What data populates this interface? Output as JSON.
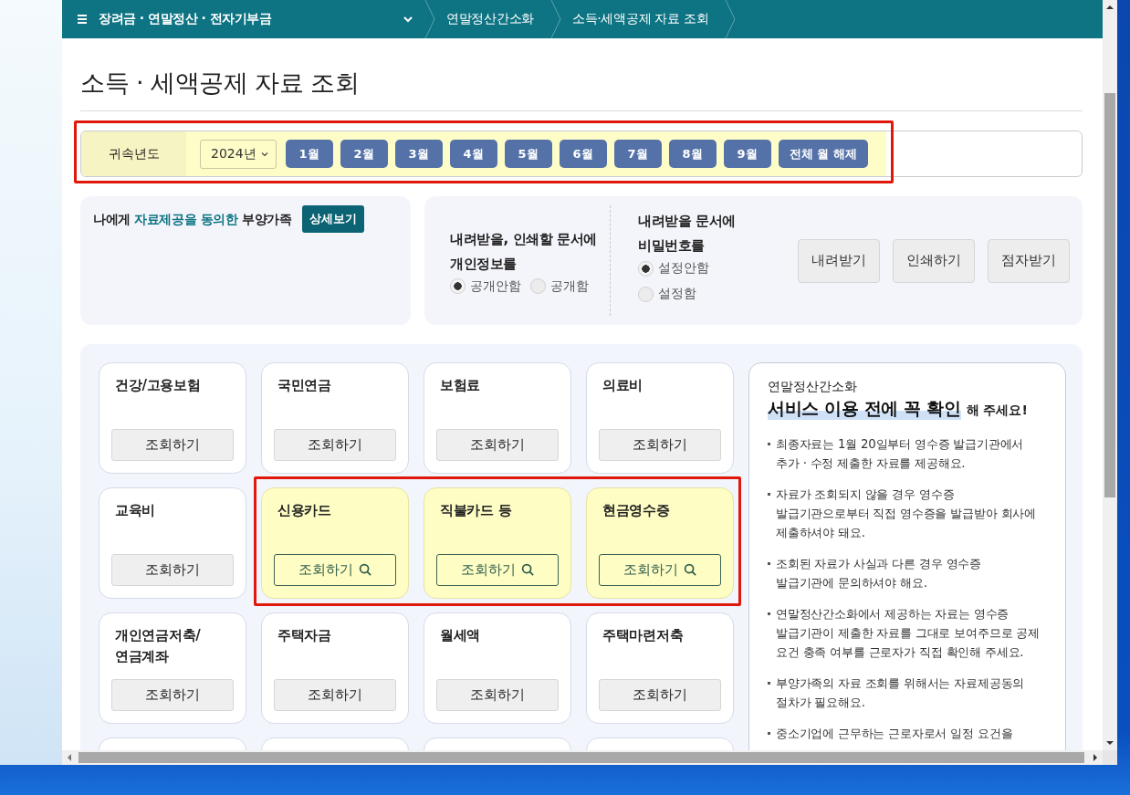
{
  "nav": {
    "title": "장려금 · 연말정산 · 전자기부금",
    "breadcrumbs": [
      "연말정산간소화",
      "소득·세액공제 자료 조회"
    ]
  },
  "page_title": "소득 · 세액공제 자료 조회",
  "filter": {
    "highlighted": true,
    "label": "귀속년도",
    "year": "2024년",
    "months": [
      "1월",
      "2월",
      "3월",
      "4월",
      "5월",
      "6월",
      "7월",
      "8월",
      "9월",
      "전체 월 해제"
    ]
  },
  "consent": {
    "text": "나에게 **자료제공을 동의한** 부양가족",
    "button": "상세보기"
  },
  "options": [
    {
      "kind": "inline",
      "question": "내려받을, 인쇄할 문서에\n개인정보를",
      "choices": [
        {
          "label": "공개안함",
          "selected": true
        },
        {
          "label": "공개함",
          "selected": false
        }
      ]
    },
    {
      "kind": "stacked",
      "question": "내려받을 문서에\n비밀번호를",
      "choices": [
        {
          "label": "설정안함",
          "selected": true
        },
        {
          "label": "설정함",
          "selected": false
        }
      ]
    }
  ],
  "actions": [
    "내려받기",
    "인쇄하기",
    "점자받기"
  ],
  "categories": [
    {
      "kind": "card",
      "name": "건강/고용보험",
      "button": "조회하기",
      "highlighted": false
    },
    {
      "kind": "card",
      "name": "국민연금",
      "button": "조회하기",
      "highlighted": false
    },
    {
      "kind": "card",
      "name": "보험료",
      "button": "조회하기",
      "highlighted": false
    },
    {
      "kind": "card",
      "name": "의료비",
      "button": "조회하기",
      "highlighted": false
    },
    {
      "kind": "card",
      "name": "교육비",
      "button": "조회하기",
      "highlighted": false
    },
    {
      "kind": "card",
      "name": "신용카드",
      "button": "조회하기",
      "highlighted": true
    },
    {
      "kind": "card",
      "name": "직불카드 등",
      "button": "조회하기",
      "highlighted": true
    },
    {
      "kind": "card",
      "name": "현금영수증",
      "button": "조회하기",
      "highlighted": true
    },
    {
      "kind": "card",
      "name": "개인연금저축/\n연금계좌",
      "button": "조회하기",
      "highlighted": false
    },
    {
      "kind": "card",
      "name": "주택자금",
      "button": "조회하기",
      "highlighted": false
    },
    {
      "kind": "card",
      "name": "월세액",
      "button": "조회하기",
      "highlighted": false
    },
    {
      "kind": "card",
      "name": "주택마련저축",
      "button": "조회하기",
      "highlighted": false
    },
    {
      "kind": "cut"
    },
    {
      "kind": "cut"
    },
    {
      "kind": "cut"
    },
    {
      "kind": "cut"
    }
  ],
  "notice": {
    "eyebrow": "연말정산간소화",
    "headline": "서비스 이용 전에 꼭 확인",
    "headline_suffix": "해 주세요!",
    "items": [
      "최종자료는 1월 20일부터 영수증 발급기관에서\n추가 · 수정 제출한 자료를 제공해요.",
      "자료가 조회되지 않을 경우 영수증\n발급기관으로부터 직접 영수증을 발급받아 회사에\n제출하셔야 돼요.",
      "조회된 자료가 사실과 다른 경우 영수증\n발급기관에 문의하셔야 해요.",
      "연말정산간소화에서 제공하는 자료는 영수증\n발급기관이 제출한 자료를 그대로 보여주므로 공제\n요건 충족 여부를 근로자가 직접 확인해 주세요.",
      "부양가족의 자료 조회를 위해서는 자료제공동의\n절차가 필요해요.",
      "중소기업에 근무하는 근로자로서 일정 요건을"
    ]
  }
}
